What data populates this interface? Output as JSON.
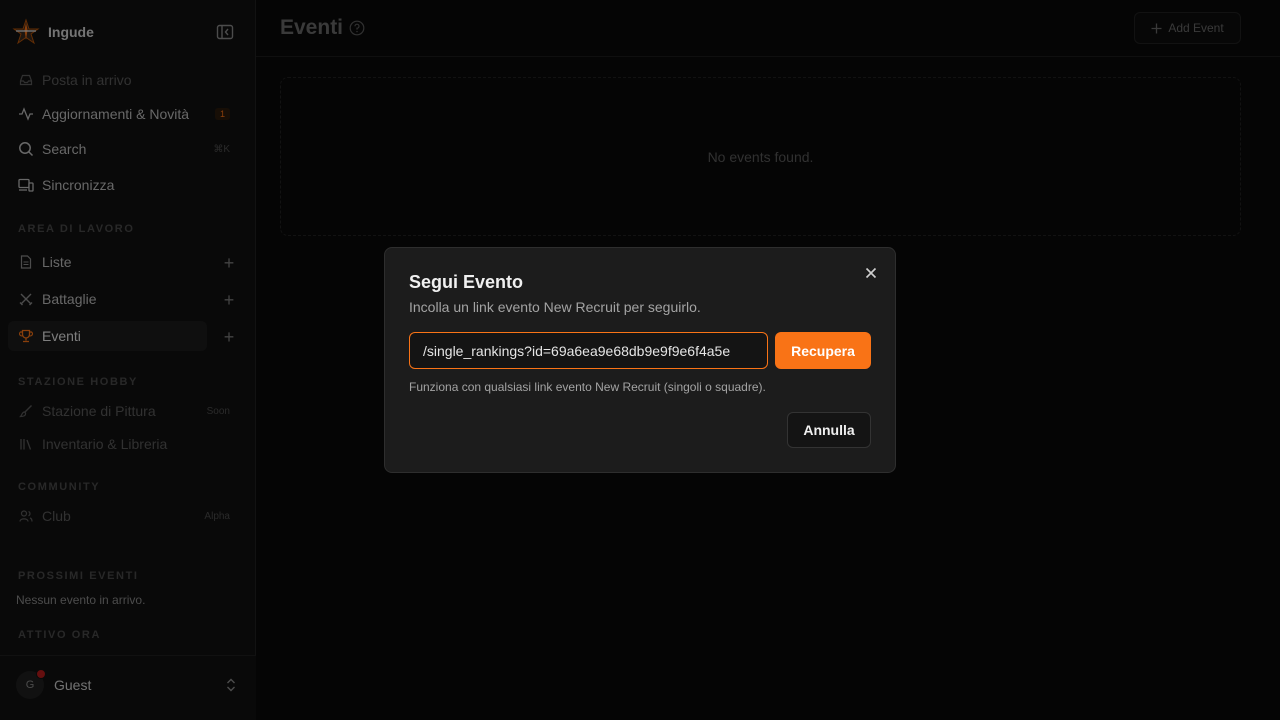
{
  "app": {
    "name": "Ingude"
  },
  "sidebar": {
    "items": [
      {
        "label": "Posta in arrivo",
        "icon": "inbox-icon"
      },
      {
        "label": "Aggiornamenti & Novità",
        "icon": "activity-icon",
        "badge": "1"
      },
      {
        "label": "Search",
        "icon": "search-icon",
        "shortcut": "⌘K"
      },
      {
        "label": "Sincronizza",
        "icon": "devices-icon"
      }
    ],
    "workspace": {
      "heading": "AREA DI LAVORO",
      "items": [
        {
          "label": "Liste",
          "icon": "file-icon"
        },
        {
          "label": "Battaglie",
          "icon": "swords-icon"
        },
        {
          "label": "Eventi",
          "icon": "trophy-icon"
        }
      ]
    },
    "hobby": {
      "heading": "STAZIONE HOBBY",
      "items": [
        {
          "label": "Stazione di Pittura",
          "icon": "brush-icon",
          "tag": "Soon"
        },
        {
          "label": "Inventario & Libreria",
          "icon": "library-icon"
        }
      ]
    },
    "community": {
      "heading": "COMMUNITY",
      "items": [
        {
          "label": "Club",
          "icon": "users-icon",
          "tag": "Alpha"
        }
      ]
    },
    "upcoming": {
      "heading": "PROSSIMI EVENTI",
      "text": "Nessun evento in arrivo."
    },
    "active_now": {
      "heading": "ATTIVO ORA"
    },
    "user": {
      "initial": "G",
      "name": "Guest"
    }
  },
  "header": {
    "title": "Eventi",
    "add_label": "Add Event"
  },
  "main": {
    "empty_text": "No events found."
  },
  "dialog": {
    "title": "Segui Evento",
    "description": "Incolla un link evento New Recruit per seguirlo.",
    "input_value": "/single_rankings?id=69a6ea9e68db9e9f9e6f4a5e",
    "fetch_label": "Recupera",
    "hint": "Funziona con qualsiasi link evento New Recruit (singoli o squadre).",
    "cancel_label": "Annulla"
  },
  "colors": {
    "accent": "#f97316",
    "background": "#0a0a0a",
    "sidebar": "#121212",
    "dialog": "#1c1c1c"
  }
}
